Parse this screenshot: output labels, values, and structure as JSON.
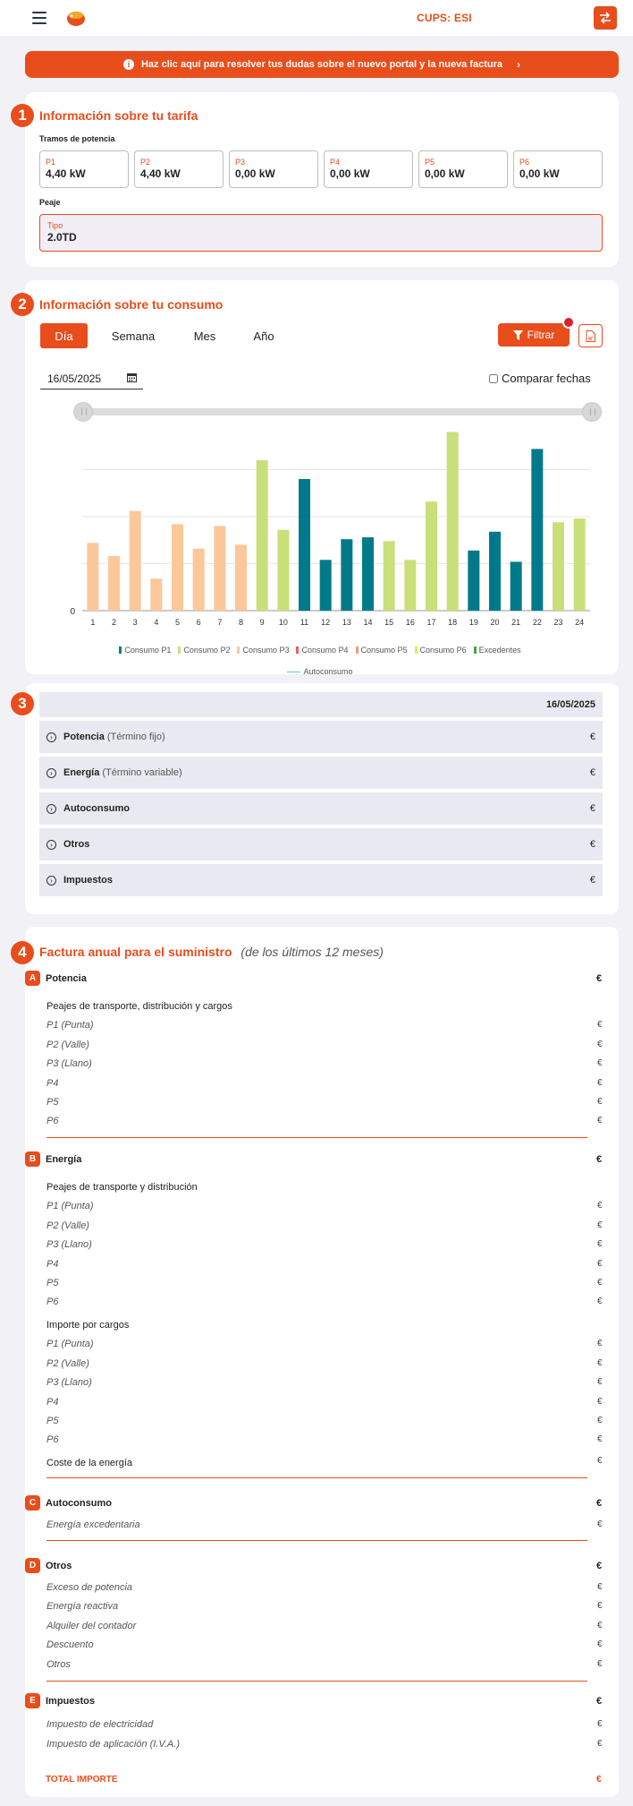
{
  "header": {
    "cups_label": "CUPS: ESI"
  },
  "banner": {
    "text": "Haz clic aquí para resolver tus dudas sobre el nuevo portal y la nueva factura",
    "chevron": "›"
  },
  "sections": {
    "tarifa": {
      "number": "1",
      "title": "Información sobre tu tarifa",
      "tramos_label": "Tramos de potencia",
      "tramos": [
        {
          "key": "P1",
          "value": "4,40 kW"
        },
        {
          "key": "P2",
          "value": "4,40 kW"
        },
        {
          "key": "P3",
          "value": "0,00 kW"
        },
        {
          "key": "P4",
          "value": "0,00 kW"
        },
        {
          "key": "P5",
          "value": "0,00 kW"
        },
        {
          "key": "P6",
          "value": "0,00 kW"
        }
      ],
      "peaje_label": "Peaje",
      "peaje": {
        "key": "Tipo",
        "value": "2.0TD"
      }
    },
    "consumo": {
      "number": "2",
      "title": "Información sobre tu consumo",
      "tabs": [
        "Día",
        "Semana",
        "Mes",
        "Año"
      ],
      "active_tab": "Día",
      "filter_label": "Filtrar",
      "date_value": "16/05/2025",
      "compare_label": "Comparar fechas"
    },
    "resumen": {
      "number": "3",
      "date": "16/05/2025",
      "rows": [
        {
          "title": "Potencia",
          "subtitle": "(Término fijo)",
          "value": "€"
        },
        {
          "title": "Energía",
          "subtitle": "(Término variable)",
          "value": "€"
        },
        {
          "title": "Autoconsumo",
          "subtitle": "",
          "value": "€"
        },
        {
          "title": "Otros",
          "subtitle": "",
          "value": "€"
        },
        {
          "title": "Impuestos",
          "subtitle": "",
          "value": "€"
        }
      ]
    },
    "factura": {
      "number": "4",
      "title": "Factura anual para el suministro",
      "subtitle": "(de los últimos 12 meses)",
      "groups": {
        "A": {
          "letter": "A",
          "title": "Potencia",
          "value": "€",
          "sub1": "Peajes de transporte, distribución y cargos",
          "items": [
            "P1 (Punta)",
            "P2 (Valle)",
            "P3 (Llano)",
            "P4",
            "P5",
            "P6"
          ]
        },
        "B": {
          "letter": "B",
          "title": "Energía",
          "value": "€",
          "sub1": "Peajes de transporte y distribución",
          "items1": [
            "P1 (Punta)",
            "P2 (Valle)",
            "P3 (Llano)",
            "P4",
            "P5",
            "P6"
          ],
          "sub2": "Importe por cargos",
          "items2": [
            "P1 (Punta)",
            "P2 (Valle)",
            "P3 (Llano)",
            "P4",
            "P5",
            "P6"
          ],
          "sub3": "Coste de la energía"
        },
        "C": {
          "letter": "C",
          "title": "Autoconsumo",
          "value": "€",
          "items": [
            "Energía excedentaria"
          ]
        },
        "D": {
          "letter": "D",
          "title": "Otros",
          "value": "€",
          "items": [
            "Exceso de potencia",
            "Energía reactiva",
            "Alquiler del contador",
            "Descuento",
            "Otros"
          ]
        },
        "E": {
          "letter": "E",
          "title": "Impuestos",
          "value": "€",
          "items": [
            "Impuesto de electricidad",
            "Impuesto de aplicación (I.V.A.)"
          ]
        }
      },
      "euro": "€",
      "total_label": "TOTAL IMPORTE",
      "total_value": "€"
    }
  },
  "colors": {
    "accent": "#e84d1c",
    "p1": "#007a8a",
    "p2": "#c9df7a",
    "p3": "#fcc79a",
    "p4": "#f25c5c",
    "p5": "#e8a07a",
    "p6": "#e5e94a",
    "excedentes": "#3aa845",
    "autoconsumo": "#5fcfc9"
  },
  "chart_data": {
    "type": "bar",
    "categories": [
      "1",
      "2",
      "3",
      "4",
      "5",
      "6",
      "7",
      "8",
      "9",
      "10",
      "11",
      "12",
      "13",
      "14",
      "15",
      "16",
      "17",
      "18",
      "19",
      "20",
      "21",
      "22",
      "23",
      "24"
    ],
    "values": [
      0.36,
      0.29,
      0.53,
      0.17,
      0.46,
      0.33,
      0.45,
      0.35,
      0.8,
      0.43,
      0.7,
      0.27,
      0.38,
      0.39,
      0.37,
      0.27,
      0.58,
      0.95,
      0.32,
      0.42,
      0.26,
      0.86,
      0.47,
      0.49
    ],
    "series_per_bar": [
      "P3",
      "P3",
      "P3",
      "P3",
      "P3",
      "P3",
      "P3",
      "P3",
      "P2",
      "P2",
      "P1",
      "P1",
      "P1",
      "P1",
      "P2",
      "P2",
      "P2",
      "P2",
      "P1",
      "P1",
      "P1",
      "P1",
      "P2",
      "P2"
    ],
    "y_tick_labels": [
      "0"
    ],
    "ylim": [
      0,
      1
    ],
    "grid": true,
    "legend": [
      {
        "name": "Consumo P1",
        "color": "#007a8a"
      },
      {
        "name": "Consumo P2",
        "color": "#c9df7a"
      },
      {
        "name": "Consumo P3",
        "color": "#fcc79a"
      },
      {
        "name": "Consumo P4",
        "color": "#f25c5c"
      },
      {
        "name": "Consumo P5",
        "color": "#e8a07a"
      },
      {
        "name": "Consumo P6",
        "color": "#e5e94a"
      },
      {
        "name": "Excedentes",
        "color": "#3aa845"
      }
    ],
    "line_legend": {
      "name": "Autoconsumo",
      "color": "#5fcfc9"
    },
    "legend_position": "bottom"
  }
}
